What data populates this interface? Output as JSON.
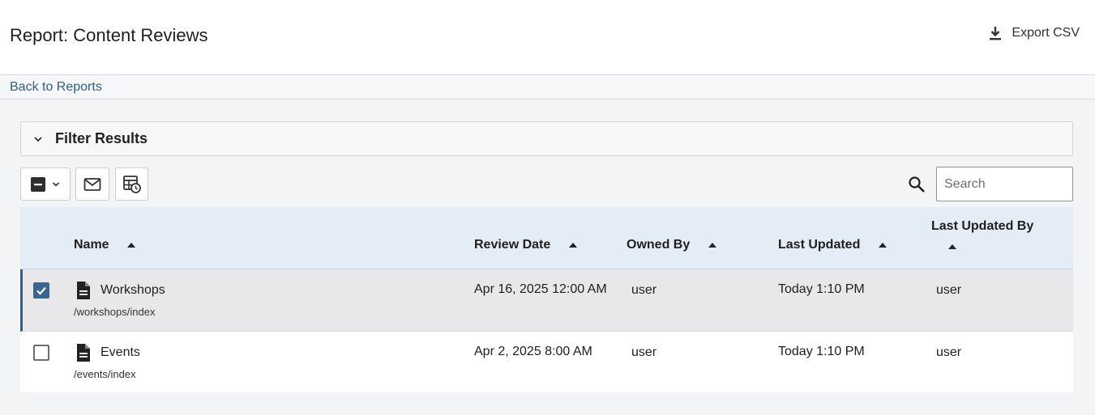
{
  "header": {
    "title": "Report: Content Reviews",
    "export_label": "Export CSV"
  },
  "nav": {
    "back_label": "Back to Reports"
  },
  "filter": {
    "title": "Filter Results",
    "expanded": false
  },
  "search": {
    "placeholder": "Search",
    "value": ""
  },
  "icons": [
    "download-icon",
    "chevron-down-icon",
    "minus-checkbox-icon",
    "mail-icon",
    "calendar-schedule-icon",
    "search-icon",
    "document-icon",
    "checkbox-checked-icon"
  ],
  "colors": {
    "accent": "#2c5e93",
    "header_bg": "#e4ecf6",
    "selected_row_bg": "#e8e8ea",
    "checkbox_checked": "#3c6493"
  },
  "table": {
    "columns": [
      {
        "key": "name",
        "label": "Name",
        "sort": "ascending"
      },
      {
        "key": "review_date",
        "label": "Review Date",
        "sort": "ascending"
      },
      {
        "key": "owned_by",
        "label": "Owned By",
        "sort": "ascending"
      },
      {
        "key": "last_updated",
        "label": "Last Updated",
        "sort": "ascending"
      },
      {
        "key": "last_updated_by",
        "label": "Last Updated By",
        "sort": "ascending"
      }
    ],
    "rows": [
      {
        "selected": true,
        "name": "Workshops",
        "path": "/workshops/index",
        "review_date": "Apr 16, 2025 12:00 AM",
        "owned_by": "user",
        "last_updated": "Today 1:10 PM",
        "last_updated_by": "user"
      },
      {
        "selected": false,
        "name": "Events",
        "path": "/events/index",
        "review_date": "Apr 2, 2025 8:00 AM",
        "owned_by": "user",
        "last_updated": "Today 1:10 PM",
        "last_updated_by": "user"
      }
    ]
  }
}
